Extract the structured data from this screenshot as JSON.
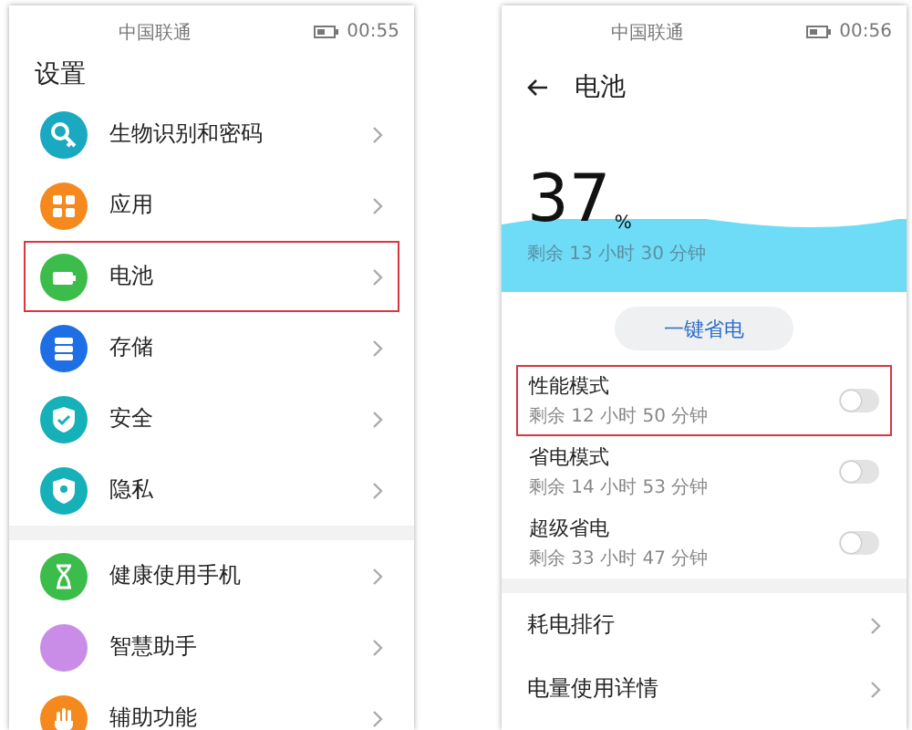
{
  "settings_screen": {
    "status_bar": {
      "carrier": "中国联通",
      "time": "00:55"
    },
    "title": "设置",
    "groups": [
      [
        {
          "label": "生物识别和密码",
          "color": "#1aa9c0",
          "highlighted": false
        },
        {
          "label": "应用",
          "color": "#f5891e",
          "highlighted": false
        },
        {
          "label": "电池",
          "color": "#3cbc4a",
          "highlighted": true
        },
        {
          "label": "存储",
          "color": "#1e6fe6",
          "highlighted": false
        },
        {
          "label": "安全",
          "color": "#16b0b8",
          "highlighted": false
        },
        {
          "label": "隐私",
          "color": "#16b0b8",
          "highlighted": false
        }
      ],
      [
        {
          "label": "健康使用手机",
          "color": "#3cbc4a",
          "highlighted": false
        },
        {
          "label": "智慧助手",
          "color": "#c98de8",
          "highlighted": false
        },
        {
          "label": "辅助功能",
          "color": "#f5891e",
          "highlighted": false
        }
      ]
    ]
  },
  "battery_screen": {
    "status_bar": {
      "carrier": "中国联通",
      "time": "00:56"
    },
    "title": "电池",
    "percent": "37",
    "percent_unit": "%",
    "remaining": "剩余 13 小时 30 分钟",
    "save_button": "一键省电",
    "modes": [
      {
        "label": "性能模式",
        "remaining": "剩余 12 小时 50 分钟",
        "on": false,
        "highlighted": true
      },
      {
        "label": "省电模式",
        "remaining": "剩余 14 小时 53 分钟",
        "on": false,
        "highlighted": false
      },
      {
        "label": "超级省电",
        "remaining": "剩余 33 小时 47 分钟",
        "on": false,
        "highlighted": false
      }
    ],
    "links": [
      "耗电排行",
      "电量使用详情"
    ]
  }
}
